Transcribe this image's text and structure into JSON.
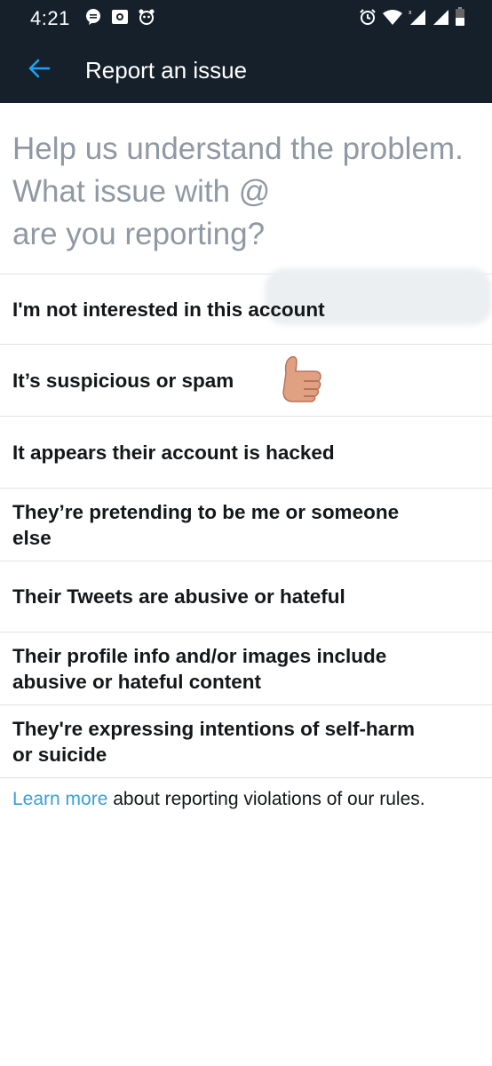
{
  "status_bar": {
    "time": "4:21",
    "left_icons": [
      "chat-bubble-icon",
      "photo-icon",
      "panda-icon"
    ],
    "right_icons": [
      "alarm-icon",
      "wifi-icon",
      "signal-icon",
      "signal-icon",
      "battery-icon"
    ]
  },
  "app_bar": {
    "title": "Report an issue"
  },
  "prompt": {
    "line1": "Help us understand the problem.",
    "line2": "What issue with @",
    "line3": "are you reporting?"
  },
  "options": [
    "I'm not interested in this account",
    "It’s suspicious or spam",
    "It appears their account is hacked",
    "They’re pretending to be me or someone else",
    "Their Tweets are abusive or hateful",
    "Their profile info and/or images include abusive or hateful content",
    "They're expressing intentions of self-harm or suicide"
  ],
  "footer": {
    "link": "Learn more",
    "text": " about reporting violations of our rules."
  },
  "colors": {
    "header_bg": "#15202b",
    "accent": "#1da1f2",
    "link": "#3b9fd9",
    "thumb": "#e0a182"
  }
}
